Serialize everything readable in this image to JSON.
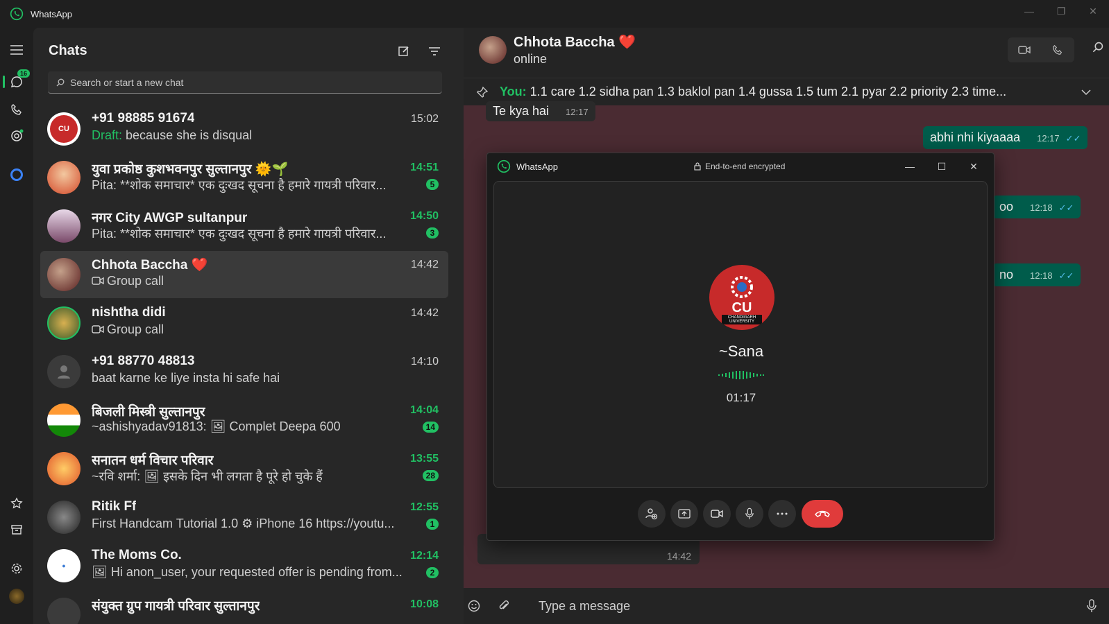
{
  "app": {
    "title": "WhatsApp"
  },
  "rail": {
    "chats_badge": "16"
  },
  "chatlist": {
    "title": "Chats",
    "search_placeholder": "Search or start a new chat",
    "chats": [
      {
        "name": "+91 98885 91674",
        "draft_label": "Draft:",
        "preview": "because she is disqual",
        "time": "15:02",
        "unread": ""
      },
      {
        "name": "युवा प्रकोष्ठ कुशभवनपुर सुल्तानपुर 🌞🌱",
        "preview": "Pita: **शोक समाचार* एक दुःखद सूचना है हमारे गायत्री परिवार...",
        "time": "14:51",
        "unread": "5"
      },
      {
        "name": "नगर City AWGP sultanpur",
        "preview": "Pita: **शोक समाचार* एक दुःखद सूचना है हमारे गायत्री परिवार...",
        "time": "14:50",
        "unread": "3"
      },
      {
        "name": "Chhota Baccha ❤️",
        "preview": "Group call",
        "time": "14:42",
        "unread": ""
      },
      {
        "name": "nishtha didi",
        "preview": "Group call",
        "time": "14:42",
        "unread": ""
      },
      {
        "name": "+91 88770 48813",
        "preview": "baat karne ke liye insta hi safe hai",
        "time": "14:10",
        "unread": ""
      },
      {
        "name": "बिजली मिस्त्री सुल्तानपुर",
        "preview": "~ashishyadav91813: 🖼 Complet Deepa 600",
        "time": "14:04",
        "unread": "14"
      },
      {
        "name": "सनातन धर्म विचार परिवार",
        "preview": "~रवि शर्मा: 🖼 इसके दिन भी लगता है पूरे हो चुके हैं",
        "time": "13:55",
        "unread": "28"
      },
      {
        "name": "Ritik Ff",
        "preview": "First Handcam Tutorial 1.0 ⚙ iPhone 16 https://youtu...",
        "time": "12:55",
        "unread": "1"
      },
      {
        "name": "The Moms Co.",
        "preview": "🖼 Hi anon_user, your requested offer is pending from...",
        "time": "12:14",
        "unread": "2"
      },
      {
        "name": "संयुक्त ग्रुप गायत्री परिवार सुल्तानपुर",
        "preview": "",
        "time": "10:08",
        "unread": ""
      }
    ]
  },
  "conversation": {
    "name": "Chhota Baccha ❤️",
    "status": "online",
    "pinned_you": "You:",
    "pinned_text": "1.1 care 1.2  sidha pan 1.3 baklol pan 1.4 gussa  1.5 tum  2.1 pyar 2.2 priority  2.3 time...",
    "msg_top_in": "Te kya hai",
    "msg_top_in_time": "12:17",
    "msg_out_1": "abhi nhi kiyaaaa",
    "msg_out_1_time": "12:17",
    "msg_out_2_frag": "oo",
    "msg_out_2_time": "12:18",
    "msg_out_3_frag": "no",
    "msg_out_3_time": "12:18",
    "call_msg_time": "14:42",
    "composer_placeholder": "Type a message"
  },
  "call": {
    "window_title": "WhatsApp",
    "e2e": "End-to-end encrypted",
    "caller_name": "~Sana",
    "timer": "01:17",
    "avatar_text": "CU",
    "avatar_sub": "CHANDIGARH UNIVERSITY"
  },
  "colors": {
    "accent": "#21c063",
    "end_call": "#e03b3b",
    "out_bubble": "#005c4b"
  }
}
